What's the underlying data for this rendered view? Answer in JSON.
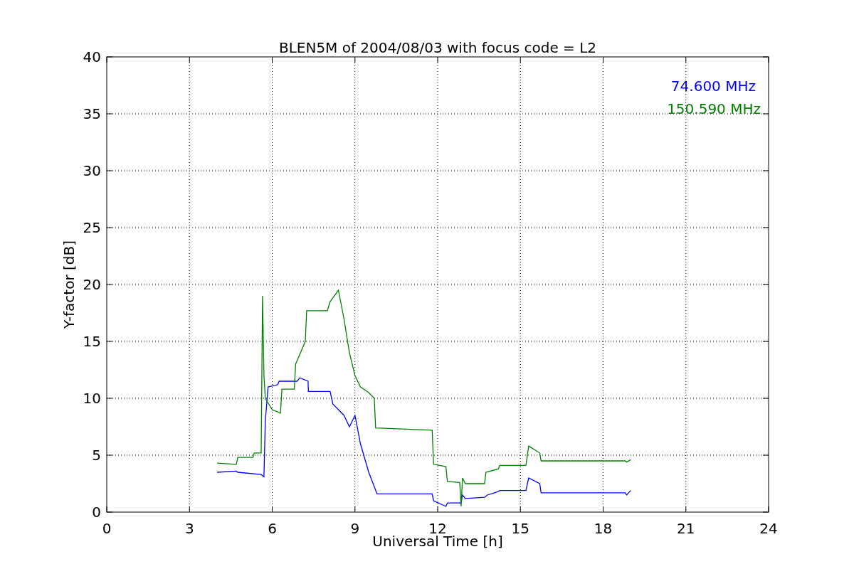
{
  "chart_data": {
    "type": "line",
    "grid": true,
    "title": "BLEN5M of 2004/08/03 with focus code = L2",
    "xlabel": "Universal Time [h]",
    "ylabel": "Y-factor [dB]",
    "xlim": [
      0,
      24
    ],
    "ylim": [
      0,
      40
    ],
    "xticks": [
      0,
      3,
      6,
      9,
      12,
      15,
      18,
      21,
      24
    ],
    "yticks": [
      0,
      5,
      10,
      15,
      20,
      25,
      30,
      35,
      40
    ],
    "series": [
      {
        "name": "74.600 MHz",
        "color": "#0000ff",
        "x": [
          4,
          4.7,
          4.75,
          5.6,
          5.7,
          5.75,
          5.85,
          6.2,
          6.25,
          6.9,
          7,
          7.3,
          7.31,
          8.1,
          8.2,
          8.6,
          8.8,
          9.0,
          9.2,
          9.5,
          9.8,
          11.8,
          11.85,
          12.3,
          12.35,
          12.85,
          12.9,
          13.0,
          13.7,
          13.8,
          14.2,
          14.25,
          15.2,
          15.3,
          15.7,
          15.75,
          18.8,
          18.85,
          19
        ],
        "values": [
          3.5,
          3.6,
          3.5,
          3.3,
          3.1,
          8,
          11,
          11.2,
          11.5,
          11.5,
          11.8,
          11.5,
          10.6,
          10.6,
          9.5,
          8.5,
          7.5,
          8.5,
          6,
          3.5,
          1.6,
          1.6,
          1.0,
          0.5,
          0.8,
          0.8,
          1.5,
          1.2,
          1.3,
          1.5,
          1.8,
          1.9,
          1.9,
          3,
          2.5,
          1.7,
          1.7,
          1.5,
          1.9
        ]
      },
      {
        "name": "150.590 MHz",
        "color": "#008000",
        "x": [
          4,
          4.7,
          4.75,
          5.3,
          5.35,
          5.6,
          5.65,
          5.7,
          5.75,
          6.0,
          6.3,
          6.35,
          6.8,
          6.85,
          7.2,
          7.25,
          8.0,
          8.1,
          8.4,
          8.6,
          8.8,
          9.0,
          9.2,
          9.5,
          9.7,
          9.75,
          11.8,
          11.85,
          12.3,
          12.35,
          12.8,
          12.85,
          12.9,
          13.0,
          13.7,
          13.75,
          14.2,
          14.25,
          15.2,
          15.3,
          15.7,
          15.75,
          18.8,
          18.85,
          19
        ],
        "values": [
          4.3,
          4.2,
          4.8,
          4.8,
          5.2,
          5.2,
          19,
          12,
          10,
          9,
          8.7,
          10.8,
          10.8,
          13,
          15,
          17.7,
          17.7,
          18.5,
          19.5,
          17,
          14,
          12,
          11,
          10.5,
          10,
          7.4,
          7.2,
          4.2,
          4,
          2.7,
          2.6,
          0.5,
          3,
          2.5,
          2.5,
          3.5,
          3.8,
          4.1,
          4.1,
          5.8,
          5.2,
          4.5,
          4.5,
          4.4,
          4.6
        ]
      }
    ]
  }
}
